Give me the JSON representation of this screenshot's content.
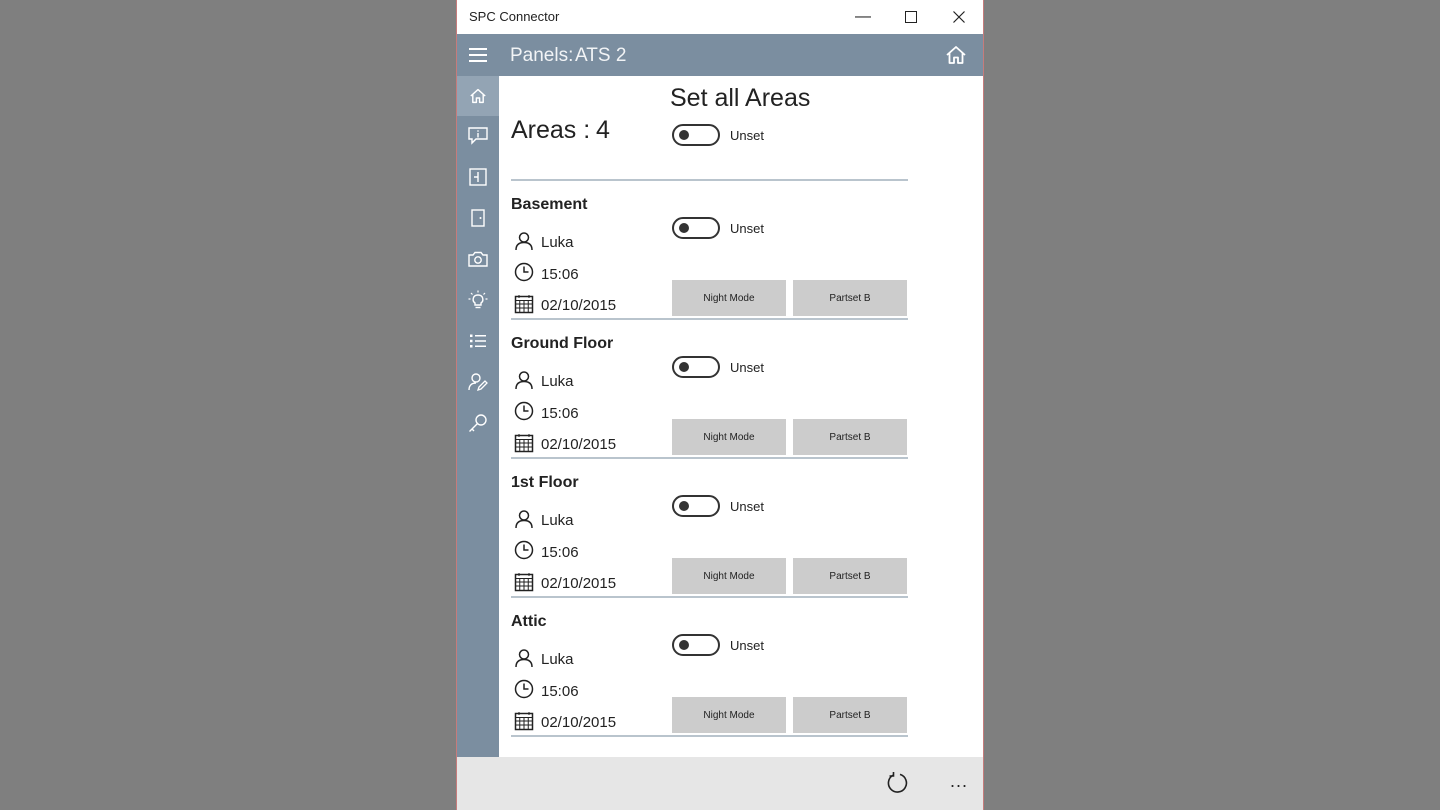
{
  "window": {
    "title": "SPC Connector",
    "minimize_glyph": "—",
    "maximize_glyph": "☐",
    "close_glyph": "✕"
  },
  "header": {
    "panels_label": "Panels:",
    "panels_value": "ATS 2"
  },
  "sidebar": {
    "items": [
      {
        "icon": "home-icon",
        "active": true
      },
      {
        "icon": "info-message-icon",
        "active": false
      },
      {
        "icon": "map-icon",
        "active": false
      },
      {
        "icon": "door-icon",
        "active": false
      },
      {
        "icon": "camera-icon",
        "active": false
      },
      {
        "icon": "lightbulb-icon",
        "active": false
      },
      {
        "icon": "list-icon",
        "active": false
      },
      {
        "icon": "user-edit-icon",
        "active": false
      },
      {
        "icon": "key-icon",
        "active": false
      }
    ]
  },
  "main": {
    "areas_label": "Areas :",
    "areas_count": "4",
    "set_all_title": "Set all Areas",
    "set_all_state": "Unset",
    "areas": [
      {
        "name": "Basement",
        "user": "Luka",
        "time": "15:06",
        "date": "02/10/2015",
        "state": "Unset",
        "button1": "Night Mode",
        "button2": "Partset B"
      },
      {
        "name": "Ground Floor",
        "user": "Luka",
        "time": "15:06",
        "date": "02/10/2015",
        "state": "Unset",
        "button1": "Night Mode",
        "button2": "Partset B"
      },
      {
        "name": "1st Floor",
        "user": "Luka",
        "time": "15:06",
        "date": "02/10/2015",
        "state": "Unset",
        "button1": "Night Mode",
        "button2": "Partset B"
      },
      {
        "name": "Attic",
        "user": "Luka",
        "time": "15:06",
        "date": "02/10/2015",
        "state": "Unset",
        "button1": "Night Mode",
        "button2": "Partset B"
      }
    ]
  },
  "bottombar": {
    "more_glyph": "..."
  },
  "colors": {
    "accent": "#7b8ea0",
    "accent_active": "#93a4b4",
    "desktop": "#7f7f7f",
    "button": "#cccccc",
    "divider": "#b9c4cd"
  }
}
